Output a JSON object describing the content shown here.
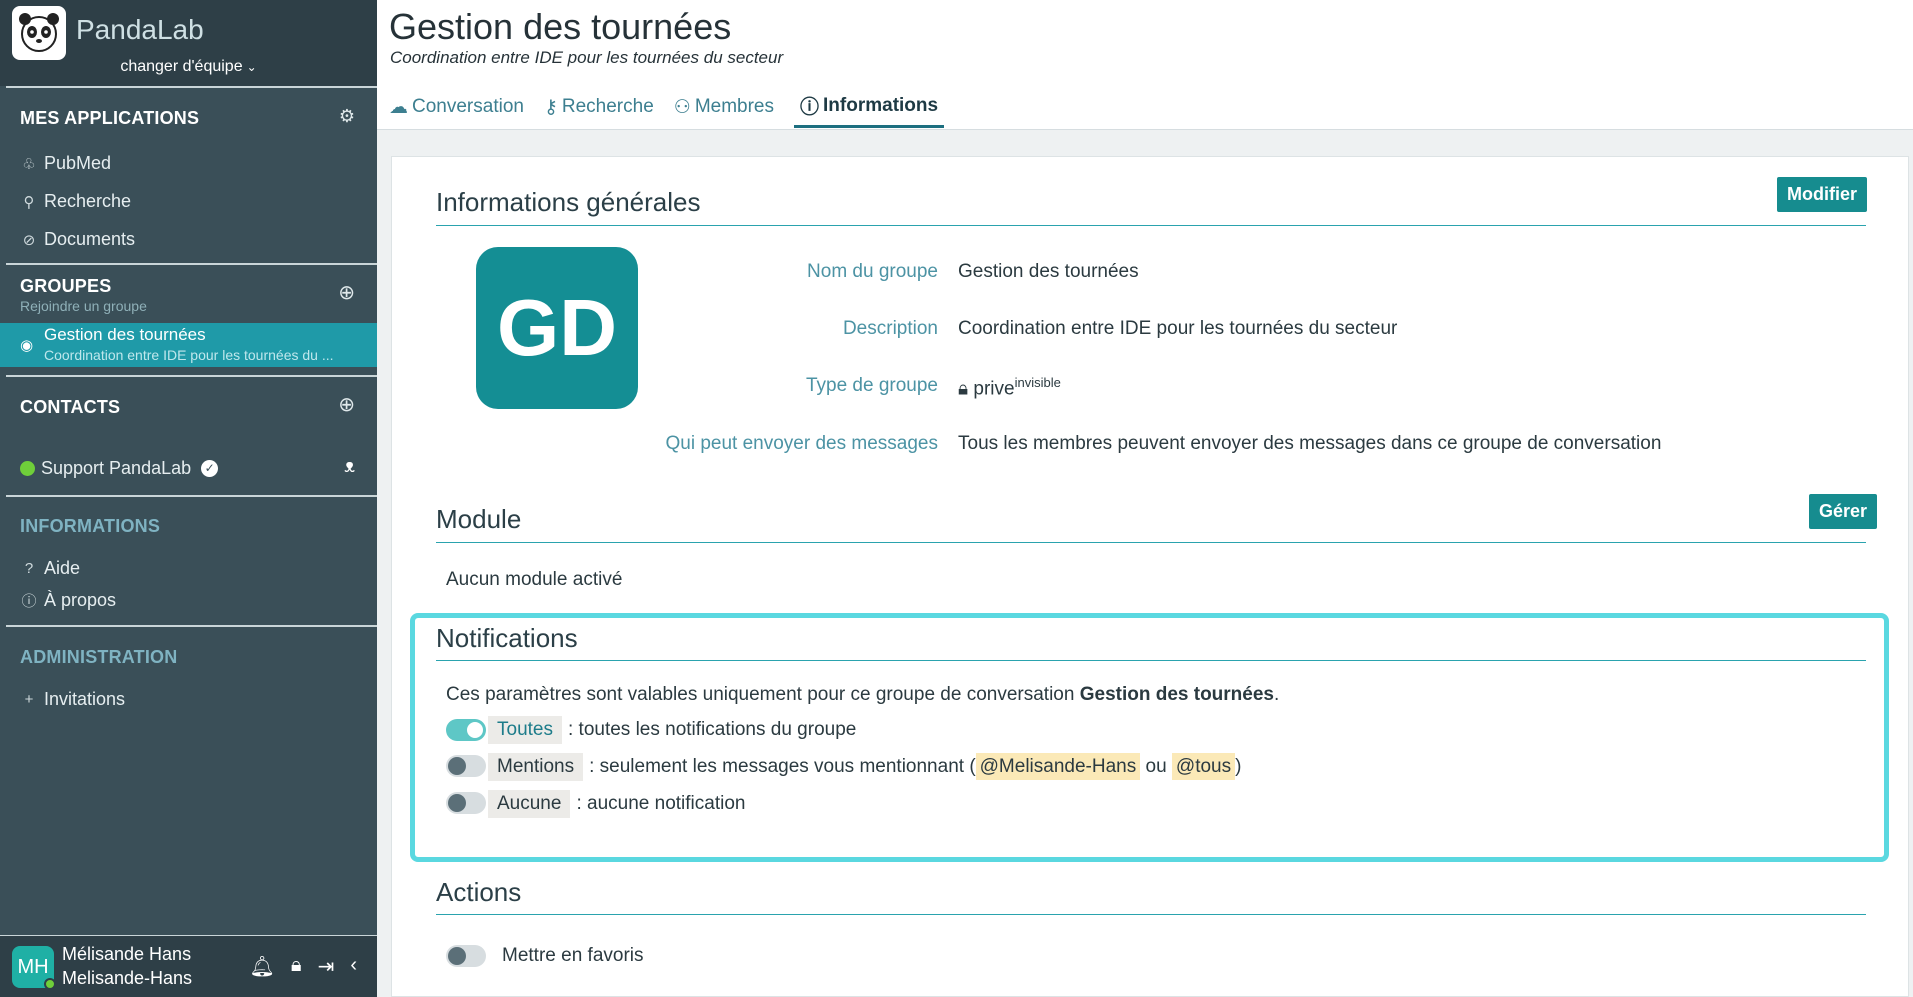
{
  "sidebar": {
    "brand": "PandaLab",
    "team_switch": "changer d'équipe",
    "apps": {
      "title": "MES APPLICATIONS",
      "items": [
        {
          "label": "PubMed",
          "icon": "pubmed-icon"
        },
        {
          "label": "Recherche",
          "icon": "search-icon"
        },
        {
          "label": "Documents",
          "icon": "paperclip-icon"
        }
      ]
    },
    "groups": {
      "title": "GROUPES",
      "subtitle": "Rejoindre un groupe",
      "active": {
        "name": "Gestion des tournées",
        "desc": "Coordination entre IDE pour les tournées du ..."
      }
    },
    "contacts": {
      "title": "CONTACTS",
      "items": [
        {
          "label": "Support PandaLab"
        }
      ]
    },
    "informations": {
      "title": "INFORMATIONS",
      "items": [
        {
          "label": "Aide",
          "glyph": "?"
        },
        {
          "label": "À propos",
          "glyph": "ⓘ"
        }
      ]
    },
    "administration": {
      "title": "ADMINISTRATION",
      "items": [
        {
          "label": "Invitations",
          "glyph": "+"
        }
      ]
    },
    "user": {
      "initials": "MH",
      "name": "Mélisande Hans",
      "handle": "Melisande-Hans"
    }
  },
  "header": {
    "title": "Gestion des tournées",
    "subtitle": "Coordination entre IDE pour les tournées du secteur",
    "tabs": [
      {
        "label": "Conversation",
        "icon": "chat-icon"
      },
      {
        "label": "Recherche",
        "icon": "wrench-icon"
      },
      {
        "label": "Membres",
        "icon": "members-icon"
      },
      {
        "label": "Informations",
        "icon": "info-icon"
      }
    ]
  },
  "general": {
    "title": "Informations générales",
    "edit_label": "Modifier",
    "avatar_initials": "GD",
    "rows": [
      {
        "label": "Nom du groupe",
        "value": "Gestion des tournées"
      },
      {
        "label": "Description",
        "value": "Coordination entre IDE pour les tournées du secteur"
      },
      {
        "label": "Type de groupe",
        "value": "prive",
        "sup": "invisible"
      },
      {
        "label": "Qui peut envoyer des messages",
        "value": "Tous les membres peuvent envoyer des messages dans ce groupe de conversation"
      }
    ]
  },
  "module": {
    "title": "Module",
    "manage_label": "Gérer",
    "empty": "Aucun module activé"
  },
  "notifications": {
    "title": "Notifications",
    "intro": "Ces paramètres sont valables uniquement pour ce groupe de conversation",
    "intro_group": "Gestion des tournées",
    "intro_end": ".",
    "options": [
      {
        "chip": "Toutes",
        "desc": ": toutes les notifications du groupe",
        "on": true
      },
      {
        "chip": "Mentions",
        "desc": ": seulement les messages vous mentionnant (",
        "mention1": "@Melisande-Hans",
        "or": "ou",
        "mention2": "@tous",
        "close": ")",
        "on": false
      },
      {
        "chip": "Aucune",
        "desc": ": aucune notification",
        "on": false
      }
    ]
  },
  "actions": {
    "title": "Actions",
    "favorite_label": "Mettre en favoris"
  }
}
